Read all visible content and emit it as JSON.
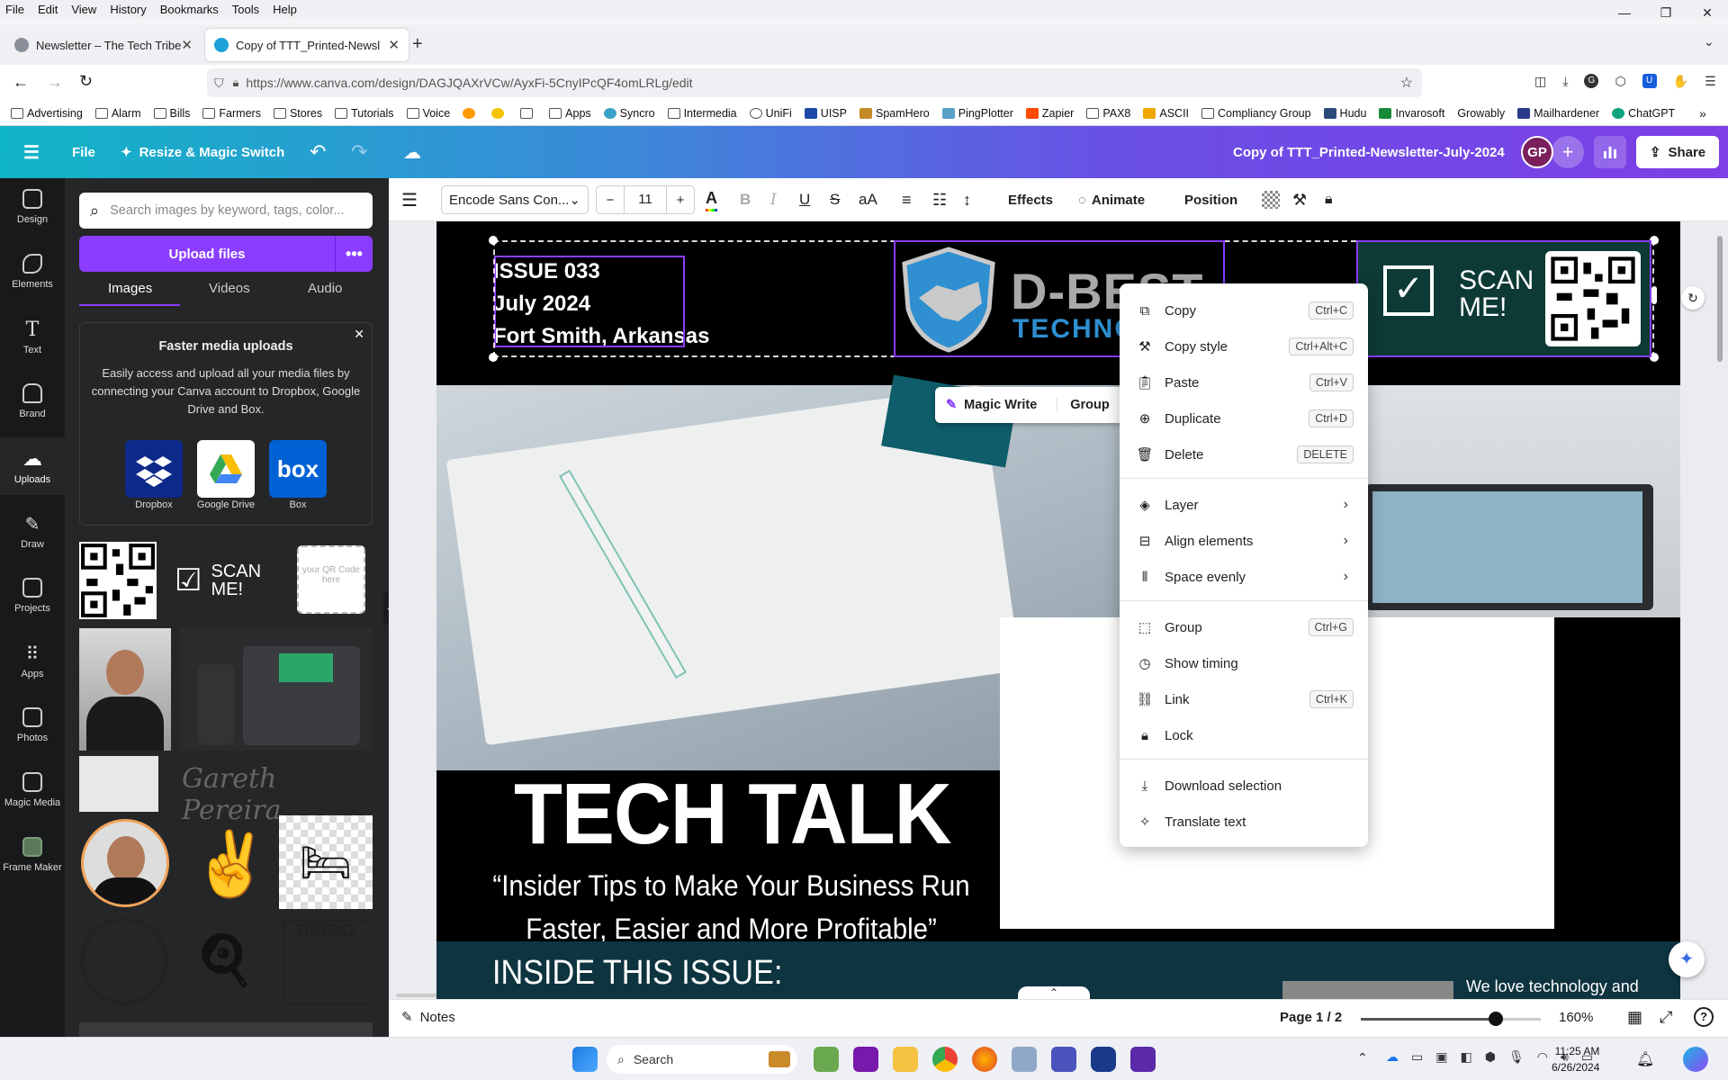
{
  "browser": {
    "menu": [
      "File",
      "Edit",
      "View",
      "History",
      "Bookmarks",
      "Tools",
      "Help"
    ],
    "tabs": [
      {
        "title": "Newsletter – The Tech Tribe",
        "active": false
      },
      {
        "title": "Copy of TTT_Printed-Newslette",
        "active": true
      }
    ],
    "url": "https://www.canva.com/design/DAGJQAXrVCw/AyxFi-5CnyIPcQF4omLRLg/edit",
    "bookmarks": [
      "Advertising",
      "Alarm",
      "Bills",
      "Farmers",
      "Stores",
      "Tutorials",
      "Voice",
      "Apps",
      "Syncro",
      "Intermedia",
      "UniFi",
      "UISP",
      "SpamHero",
      "PingPlotter",
      "Zapier",
      "PAX8",
      "ASCII",
      "Compliancy Group",
      "Hudu",
      "Invarosoft",
      "Growably",
      "Mailhardener",
      "ChatGPT"
    ]
  },
  "canva_header": {
    "file": "File",
    "resize": "Resize & Magic Switch",
    "doc_title": "Copy of  TTT_Printed-Newsletter-July-2024",
    "avatar": "GP",
    "share": "Share"
  },
  "rail": [
    "Design",
    "Elements",
    "Text",
    "Brand",
    "Uploads",
    "Draw",
    "Projects",
    "Apps",
    "Photos",
    "Magic Media",
    "Frame Maker"
  ],
  "uploads_panel": {
    "search_placeholder": "Search images by keyword, tags, color...",
    "upload_button": "Upload files",
    "tabs": [
      "Images",
      "Videos",
      "Audio"
    ],
    "tip_title": "Faster media uploads",
    "tip_body": "Easily access and upload all your media files by connecting your Canva account to Dropbox, Google Drive and Box.",
    "services": [
      "Dropbox",
      "Google Drive",
      "Box"
    ],
    "scan_text": "SCAN ME!",
    "qr_placeholder": "your QR Code here",
    "signature": "Gareth Pereira",
    "bingo": "BINGO"
  },
  "toolbar": {
    "font": "Encode Sans Con...",
    "font_size": "11",
    "effects": "Effects",
    "animate": "Animate",
    "position": "Position"
  },
  "newsletter": {
    "issue": "ISSUE 033",
    "date": "July 2024",
    "location": "Fort Smith, Arkansas",
    "logo_text": "D-BEST",
    "logo_sub": "TECHNO",
    "scan": "SCAN ME!",
    "floating_magic": "Magic Write",
    "floating_group": "Group",
    "headline": "TECH TALK",
    "subhead_1": "“Insider Tips to Make Your Business Run",
    "subhead_2": "Faster, Easier and More Profitable”",
    "inside": "INSIDE THIS ISSUE:",
    "side_text": "We love technology and"
  },
  "context_menu": [
    {
      "label": "Copy",
      "shortcut": "Ctrl+C",
      "icon": "copy-icon"
    },
    {
      "label": "Copy style",
      "shortcut": "Ctrl+Alt+C",
      "icon": "paint-roller-icon"
    },
    {
      "label": "Paste",
      "shortcut": "Ctrl+V",
      "icon": "clipboard-icon"
    },
    {
      "label": "Duplicate",
      "shortcut": "Ctrl+D",
      "icon": "duplicate-icon"
    },
    {
      "label": "Delete",
      "shortcut": "DELETE",
      "icon": "trash-icon"
    },
    {
      "label": "Layer",
      "shortcut": "",
      "icon": "layers-icon"
    },
    {
      "label": "Align elements",
      "shortcut": "",
      "icon": "align-icon"
    },
    {
      "label": "Space evenly",
      "shortcut": "",
      "icon": "space-evenly-icon"
    },
    {
      "label": "Group",
      "shortcut": "Ctrl+G",
      "icon": "group-icon"
    },
    {
      "label": "Show timing",
      "shortcut": "",
      "icon": "clock-icon"
    },
    {
      "label": "Link",
      "shortcut": "Ctrl+K",
      "icon": "link-icon"
    },
    {
      "label": "Lock",
      "shortcut": "",
      "icon": "lock-icon"
    },
    {
      "label": "Download selection",
      "shortcut": "",
      "icon": "download-icon"
    },
    {
      "label": "Translate text",
      "shortcut": "",
      "icon": "translate-icon"
    }
  ],
  "status": {
    "notes": "Notes",
    "page": "Page 1 / 2",
    "zoom": "160%",
    "zoom_fraction": 0.75
  },
  "taskbar": {
    "search": "Search",
    "time": "11:25 AM",
    "date": "6/26/2024"
  },
  "colors": {
    "canva_purple": "#8b3dff",
    "teal": "#0f5c6b",
    "logo_blue": "#2f8fd0"
  }
}
